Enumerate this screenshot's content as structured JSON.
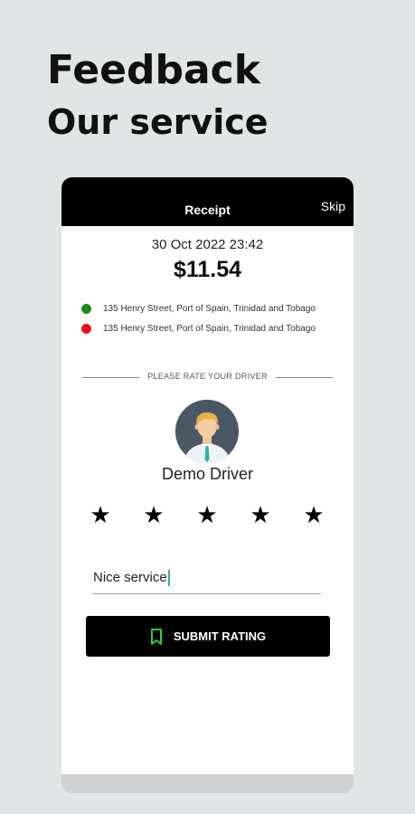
{
  "hero": {
    "title": "Feedback",
    "subtitle": "Our service"
  },
  "appbar": {
    "title": "Receipt",
    "skip_label": "Skip"
  },
  "receipt": {
    "date": "30 Oct 2022 23:42",
    "amount": "$11.54",
    "pickup": {
      "address": "135 Henry Street, Port of Spain, Trinidad and Tobago",
      "color": "#1a8a1a"
    },
    "dropoff": {
      "address": "135 Henry Street, Port of Spain, Trinidad and Tobago",
      "color": "#e8121b"
    }
  },
  "rating": {
    "section_label": "PLEASE RATE YOUR DRIVER",
    "driver_name": "Demo Driver",
    "stars": 5,
    "star_icon": "star-icon",
    "comment_value": "Nice service",
    "submit_label": "SUBMIT RATING",
    "submit_icon": "bookmark-icon",
    "submit_icon_color": "#2ecc40"
  }
}
